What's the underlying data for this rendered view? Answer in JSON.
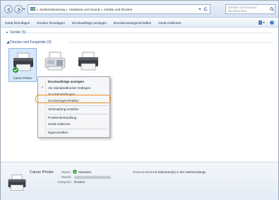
{
  "address": {
    "crumbs": [
      "Systemsteuerung",
      "Hardware und Sound",
      "Geräte und Drucker"
    ],
    "sep": "▸",
    "search_placeholder": "Geräte und Drucker durchsuchen"
  },
  "toolbar": {
    "items": [
      "Gerät hinzufügen",
      "Drucker hinzufügen",
      "Druckaufträge anzeigen",
      "Druckserver­eigenschaften",
      "Gerät entfernen"
    ]
  },
  "groups": {
    "devices": "Geräte (5)",
    "printers": "Drucker und Faxgeräte (3)"
  },
  "printers": [
    {
      "label": "Canon Printer",
      "selected": true,
      "default": true
    },
    {
      "label": "",
      "selected": false,
      "default": false
    },
    {
      "label": "",
      "selected": false,
      "default": false
    }
  ],
  "menu": {
    "items": [
      "Druckaufträge anzeigen",
      "Als Standarddrucker festlegen",
      "Druckeinstellungen",
      "Druckereigenschaften",
      "Verknüpfung erstellen",
      "Problembehandlung",
      "Gerät entfernen",
      "Eigenschaften"
    ],
    "check": "✓",
    "highlighted": "Druckereigenschaften"
  },
  "details": {
    "name": "Canon Printer",
    "status_label": "Status:",
    "status_value": "Standard",
    "model_label": "Modell:",
    "category_label": "Kategorie:",
    "category_value": "Drucker",
    "doc_status_label": "Dokumentstatus:",
    "doc_status_value": "0 Dokument(e) in der Warteschlange"
  },
  "colors": {
    "highlight": "#f08a1c",
    "link": "#1f4e8c",
    "ok": "#2e9c2e"
  }
}
